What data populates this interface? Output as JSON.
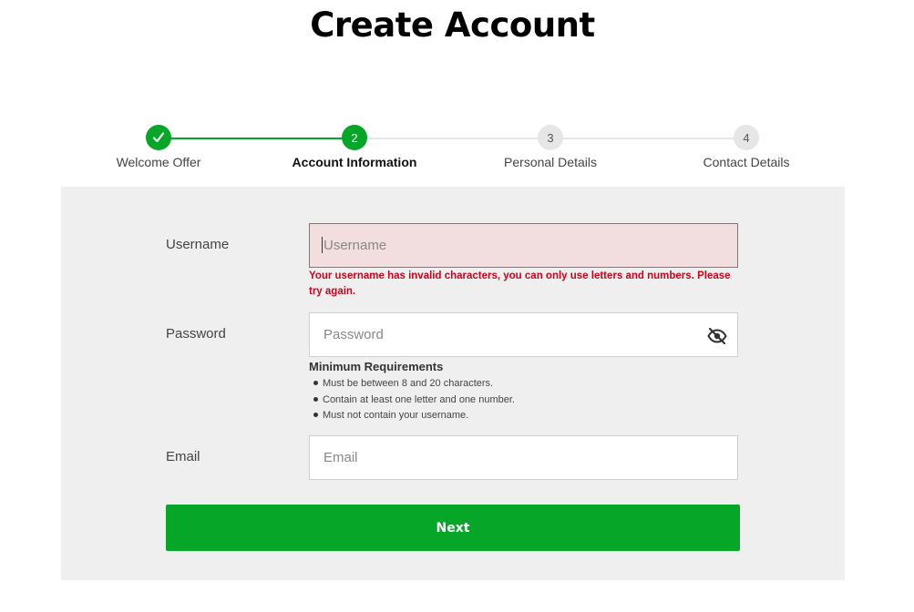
{
  "header": {
    "title": "Create Account"
  },
  "stepper": {
    "steps": [
      {
        "number": "",
        "label": "Welcome Offer",
        "state": "complete",
        "icon": "checkmark-icon"
      },
      {
        "number": "2",
        "label": "Account Information",
        "state": "active"
      },
      {
        "number": "3",
        "label": "Personal Details",
        "state": "upcoming"
      },
      {
        "number": "4",
        "label": "Contact Details",
        "state": "upcoming"
      }
    ]
  },
  "form": {
    "username": {
      "label": "Username",
      "placeholder": "Username",
      "value": "",
      "error": "Your username has invalid characters, you can only use letters and numbers. Please try again."
    },
    "password": {
      "label": "Password",
      "placeholder": "Password",
      "value": "",
      "toggle_icon": "eye-slash-icon",
      "requirements_title": "Minimum Requirements",
      "requirements": [
        "Must be between 8 and 20 characters.",
        "Contain at least one letter and one number.",
        "Must not contain your username."
      ]
    },
    "email": {
      "label": "Email",
      "placeholder": "Email",
      "value": ""
    },
    "next_label": "Next"
  },
  "colors": {
    "primary_green": "#06a628",
    "error_red": "#d0021b",
    "error_bg": "#f2dede",
    "panel_bg": "#efefef",
    "inactive_step": "#e6e6e6"
  }
}
